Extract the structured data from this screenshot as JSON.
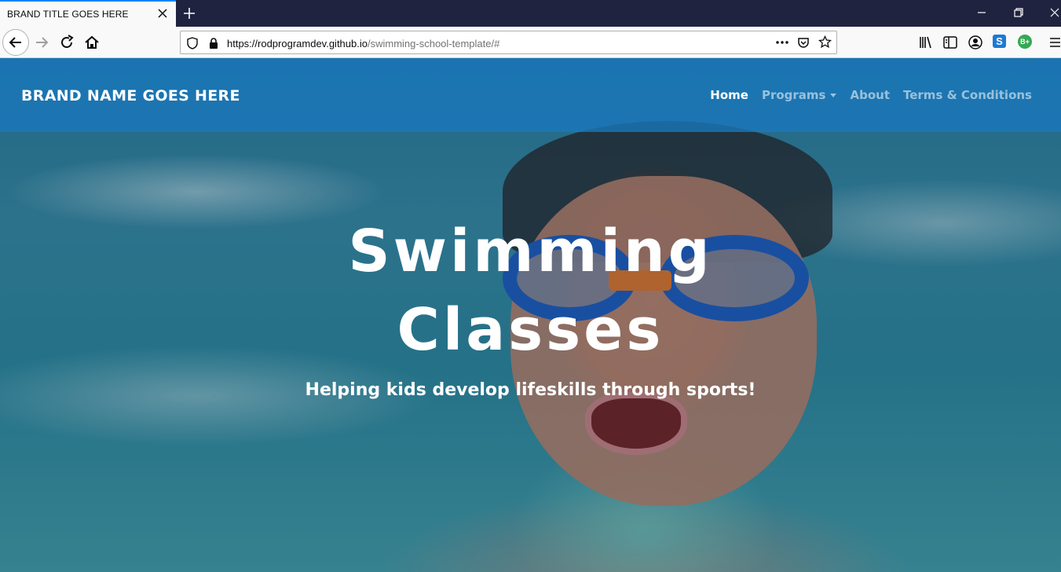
{
  "browser": {
    "tab_title": "BRAND TITLE GOES HERE",
    "url_host": "https://rodprogramdev.github.io",
    "url_path": "/swimming-school-template/#",
    "extension_badge": "B+",
    "extension_s": "S"
  },
  "site": {
    "brand": "BRAND NAME GOES HERE",
    "nav": {
      "home": "Home",
      "programs": "Programs",
      "about": "About",
      "terms": "Terms & Conditions"
    },
    "hero": {
      "title_line1": "Swimming",
      "title_line2": "Classes",
      "subtitle": "Helping kids develop lifeskills through sports!"
    }
  }
}
